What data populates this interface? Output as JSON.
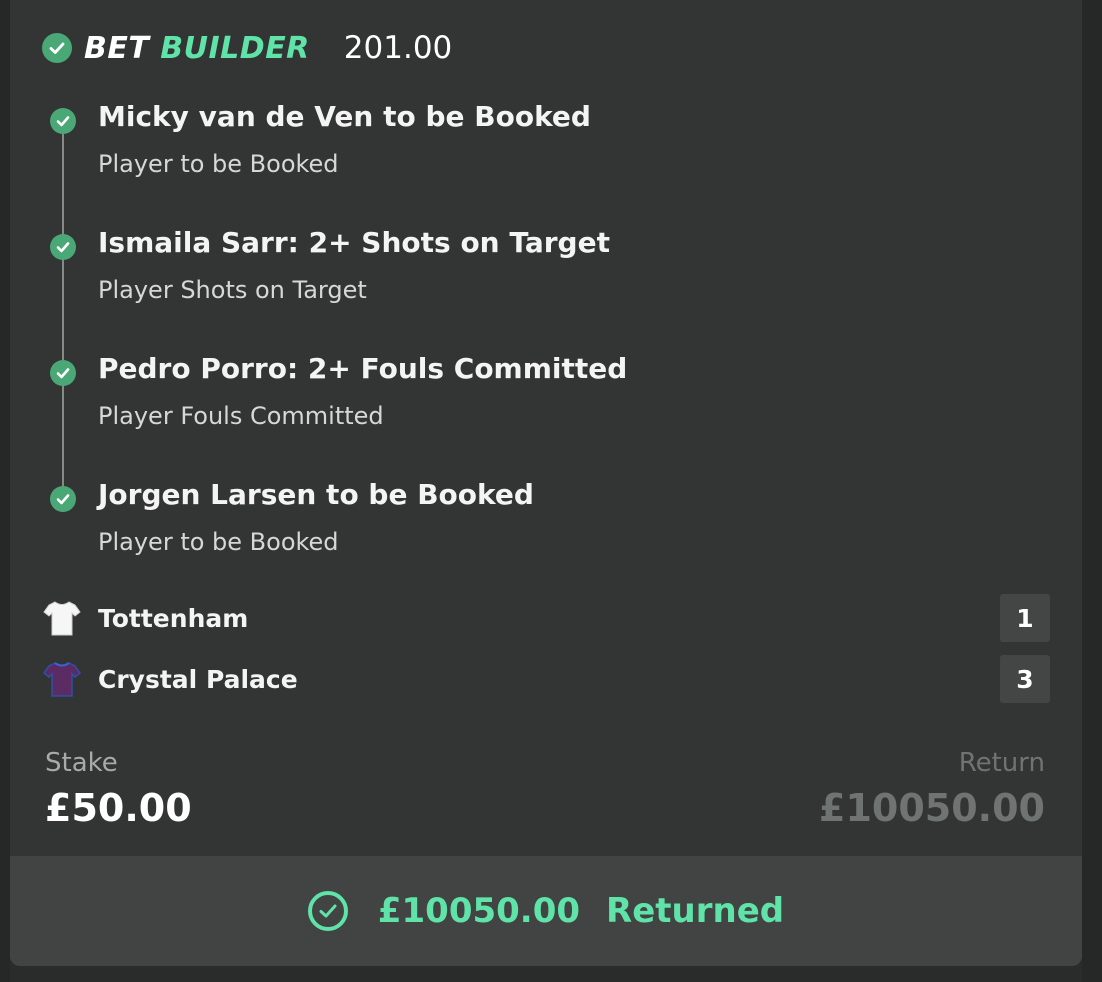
{
  "header": {
    "brand_part1": "BET",
    "brand_part2": "BUILDER",
    "odds": "201.00",
    "status_icon": "check-circle-icon"
  },
  "legs": [
    {
      "title": "Micky van de Ven to be Booked",
      "market": "Player to be Booked",
      "status": "won"
    },
    {
      "title": "Ismaila Sarr: 2+ Shots on Target",
      "market": "Player Shots on Target",
      "status": "won"
    },
    {
      "title": "Pedro Porro: 2+ Fouls Committed",
      "market": "Player Fouls Committed",
      "status": "won"
    },
    {
      "title": "Jorgen Larsen to be Booked",
      "market": "Player to be Booked",
      "status": "won"
    }
  ],
  "match": {
    "home": {
      "name": "Tottenham",
      "score": "1",
      "kit_color": "#ffffff"
    },
    "away": {
      "name": "Crystal Palace",
      "score": "3",
      "kit_color": "#5b2b63"
    }
  },
  "stake": {
    "label": "Stake",
    "value": "£50.00"
  },
  "return": {
    "label": "Return",
    "value": "£10050.00"
  },
  "result": {
    "amount": "£10050.00",
    "status": "Returned",
    "icon": "check-circle-outline-icon"
  },
  "colors": {
    "accent": "#5fe3a8",
    "check": "#4aa877",
    "card": "#323533",
    "banner": "#414443"
  }
}
